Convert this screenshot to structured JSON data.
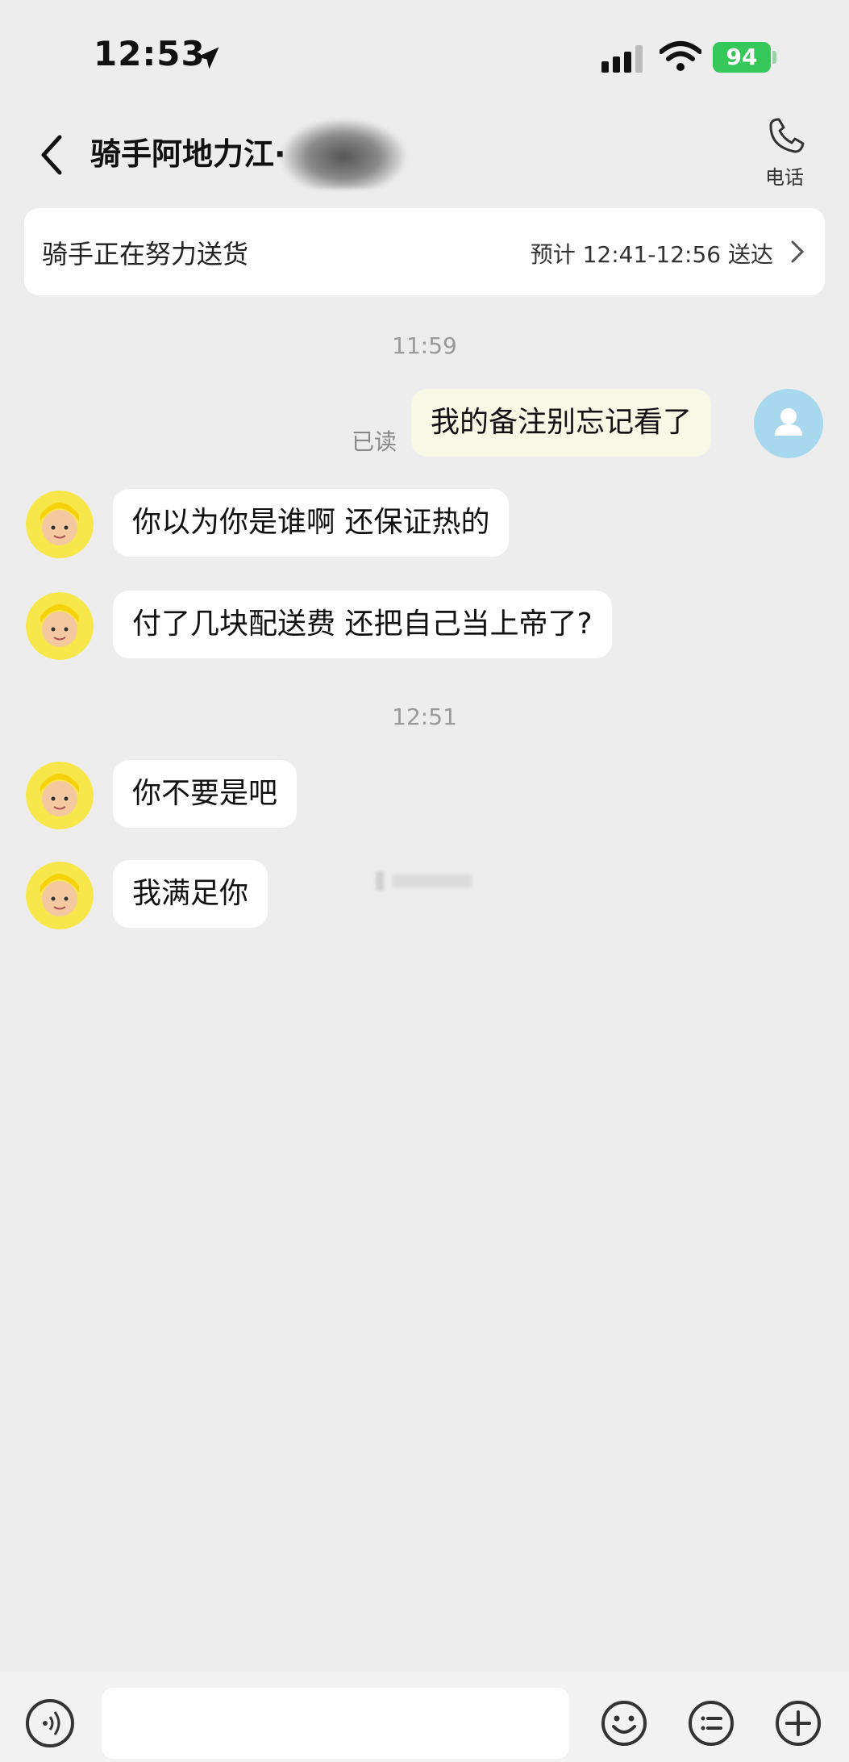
{
  "status_bar": {
    "time": "12:53",
    "battery": "94"
  },
  "header": {
    "title": "骑手阿地力江·",
    "phone_label": "电话"
  },
  "delivery": {
    "status": "骑手正在努力送货",
    "eta": "预计 12:41-12:56 送达"
  },
  "messages": {
    "time_1": "11:59",
    "mine_1": "我的备注别忘记看了",
    "read": "已读",
    "rider_1": "你以为你是谁啊 还保证热的",
    "rider_2": "付了几块配送费 还把自己当上帝了?",
    "time_2": "12:51",
    "rider_3": "你不要是吧",
    "rider_4": "我满足你"
  },
  "input": {
    "placeholder": ""
  },
  "icons": {
    "location": "location-arrow-icon",
    "signal": "cellular-signal-icon",
    "wifi": "wifi-icon",
    "back": "chevron-left-icon",
    "phone": "phone-icon",
    "chevron": "chevron-right-icon",
    "voice": "voice-icon",
    "emoji": "emoji-icon",
    "menu": "list-menu-icon",
    "plus": "plus-icon"
  },
  "colors": {
    "background": "#ededed",
    "mine_bubble": "#f8f8e6",
    "battery": "#35c759"
  }
}
